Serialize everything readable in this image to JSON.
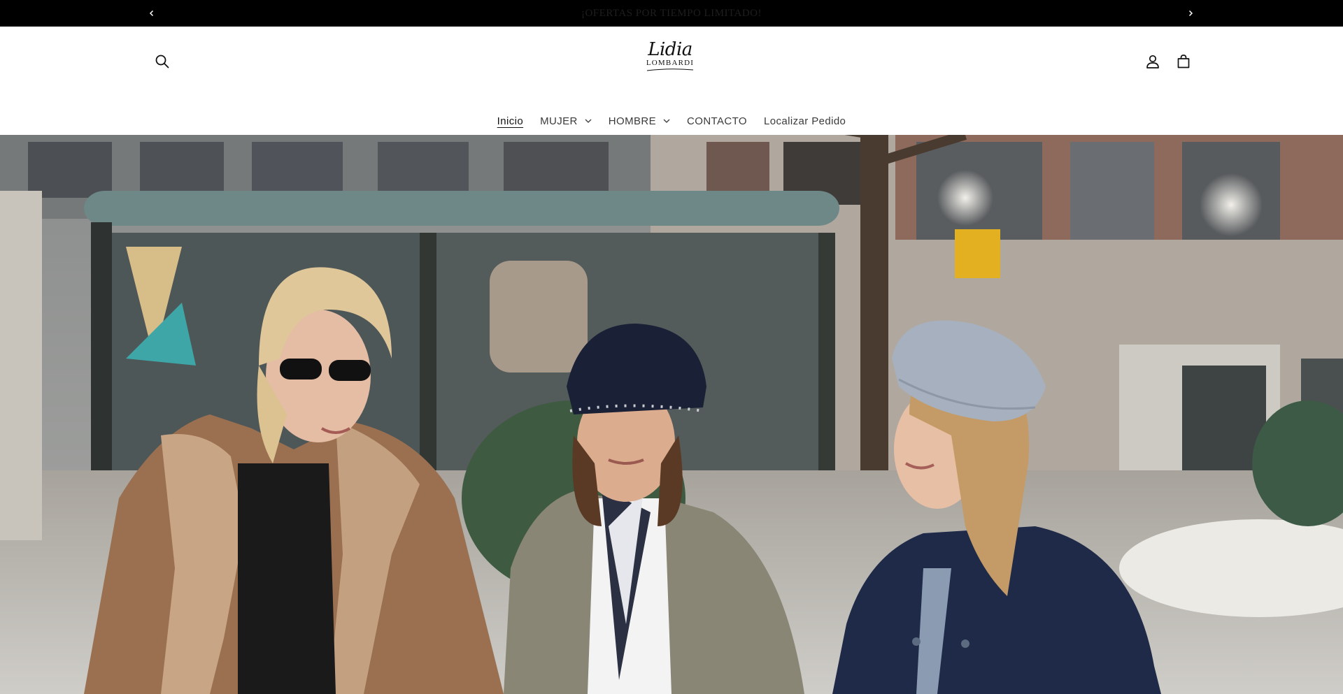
{
  "announcement": {
    "text": "¡OFERTAS POR TIEMPO LIMITADO!",
    "prev_icon": "chevron-left-icon",
    "next_icon": "chevron-right-icon"
  },
  "header": {
    "logo_script": "Lidia",
    "logo_sub": "LOMBARDI",
    "search_icon": "search-icon",
    "account_icon": "user-icon",
    "cart_icon": "cart-icon"
  },
  "nav": {
    "items": [
      {
        "label": "Inicio",
        "active": true
      },
      {
        "label": "MUJER",
        "dropdown": true
      },
      {
        "label": "HOMBRE",
        "dropdown": true
      },
      {
        "label": "CONTACTO"
      },
      {
        "label": "Localizar Pedido"
      }
    ]
  },
  "colors": {
    "announcement_bg": "#000000",
    "header_bg": "#ffffff",
    "text": "#121212"
  }
}
